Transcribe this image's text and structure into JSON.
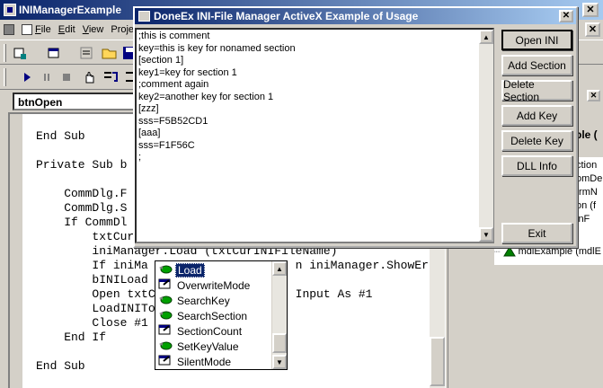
{
  "ide": {
    "title": "INIManagerExample",
    "close_glyph": "✕",
    "menus": [
      {
        "label": "File",
        "u": "F",
        "rest": "ile"
      },
      {
        "label": "Edit",
        "u": "E",
        "rest": "dit"
      },
      {
        "label": "View",
        "u": "V",
        "rest": "iew"
      },
      {
        "label": "Projec",
        "u": "",
        "rest": "Projec"
      }
    ],
    "object_combo": "btnOpen",
    "code_lines": "End Sub\n\nPrivate Sub b\n\n    CommDlg.F\n    CommDlg.S\n    If CommDl\n        txtCur\n        iniManager.Load (txtCurINIFileName)\n        If iniMa                     n iniManager.ShowErr\n        bINILoad\n        Open txtC                    Input As #1\n        LoadINITo\n        Close #1\n    End If\n\nEnd Sub",
    "properties_label": "ple (",
    "tree_lines": [
      "ction",
      "omDe",
      "frmN",
      "on (f",
      "inF"
    ],
    "tree_item": "mdlExample (mdlE"
  },
  "autocomplete": {
    "items": [
      {
        "label": "Load",
        "icon": "method-icon",
        "selected": true
      },
      {
        "label": "OverwriteMode",
        "icon": "property-icon",
        "selected": false
      },
      {
        "label": "SearchKey",
        "icon": "method-icon",
        "selected": false
      },
      {
        "label": "SearchSection",
        "icon": "method-icon",
        "selected": false
      },
      {
        "label": "SectionCount",
        "icon": "property-icon",
        "selected": false
      },
      {
        "label": "SetKeyValue",
        "icon": "method-icon",
        "selected": false
      },
      {
        "label": "SilentMode",
        "icon": "property-icon",
        "selected": false
      }
    ]
  },
  "dialog": {
    "title": "DoneEx INI-File Manager ActiveX Example of Usage",
    "close_glyph": "✕",
    "content": ";this is comment\nkey=this is key for nonamed section\n[section 1]\nkey1=key for section 1\n;comment again\nkey2=another key for section 1\n[zzz]\nsss=F5B52CD1\n[aaa]\nsss=F1F56C\n;",
    "buttons": {
      "open_ini": "Open INI",
      "add_section": "Add Section",
      "delete_section": "Delete Section",
      "add_key": "Add Key",
      "delete_key": "Delete Key",
      "dll_info": "DLL  Info",
      "exit": "Exit"
    }
  },
  "colors": {
    "titlebar_active": "#0a246a",
    "titlebar_gradient_end": "#a6caf0",
    "face": "#d4d0c8",
    "selection": "#0a246a"
  }
}
